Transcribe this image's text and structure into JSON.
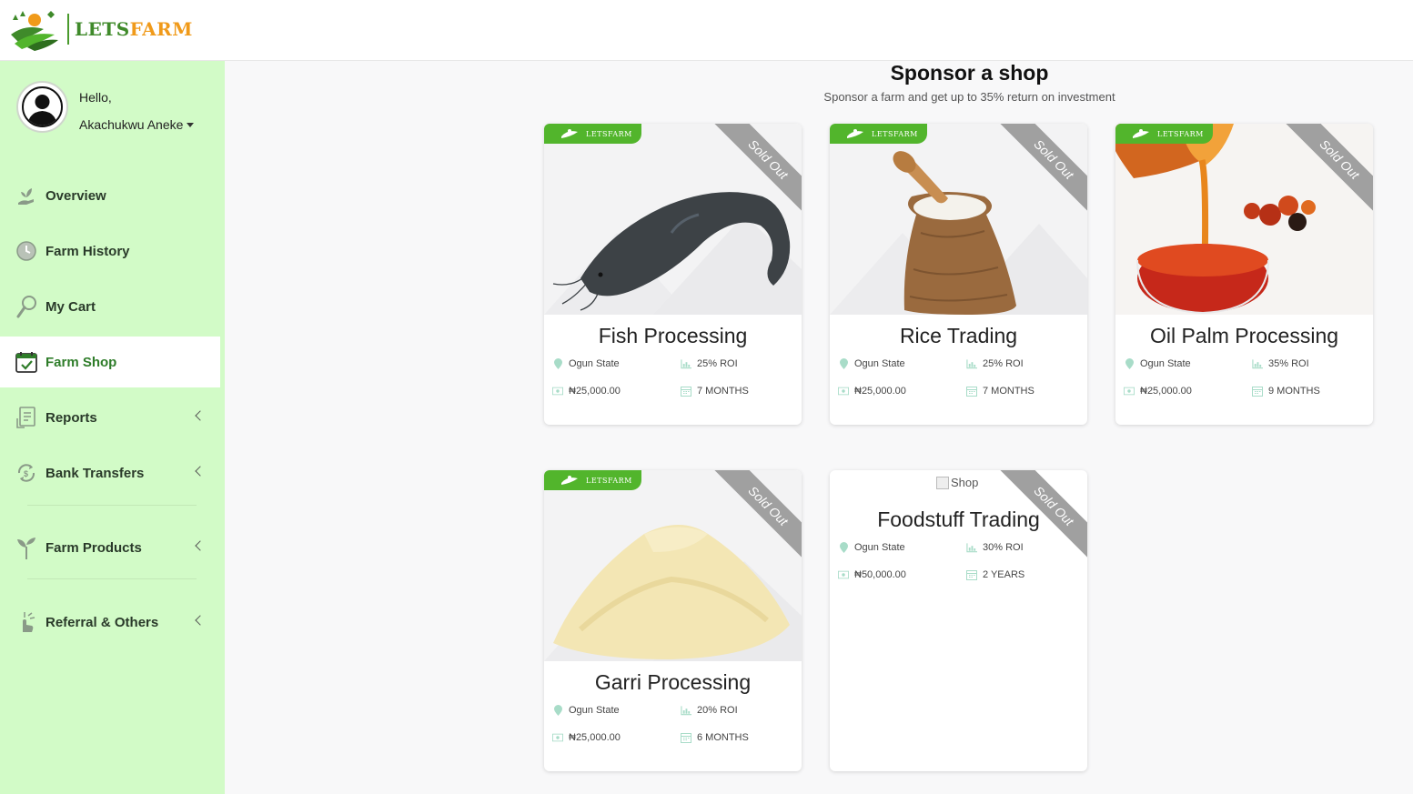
{
  "brand": {
    "lets": "LETS",
    "farm": "FARM",
    "tag_text": "LETSFARM"
  },
  "user": {
    "greeting": "Hello,",
    "name": "Akachukwu Aneke"
  },
  "nav": [
    {
      "label": "Overview",
      "icon": "hand-plant-icon",
      "active": false,
      "has_chevron": false
    },
    {
      "label": "Farm History",
      "icon": "clock-icon",
      "active": false,
      "has_chevron": false
    },
    {
      "label": "My Cart",
      "icon": "magnifier-icon",
      "active": false,
      "has_chevron": false
    },
    {
      "label": "Farm Shop",
      "icon": "calendar-check-icon",
      "active": true,
      "has_chevron": false
    },
    {
      "label": "Reports",
      "icon": "report-document-icon",
      "active": false,
      "has_chevron": true
    },
    {
      "label": "Bank Transfers",
      "icon": "money-transfer-icon",
      "active": false,
      "has_chevron": true
    },
    {
      "label": "Farm Products",
      "icon": "sprout-icon",
      "active": false,
      "has_chevron": true
    },
    {
      "label": "Referral & Others",
      "icon": "hand-pointer-icon",
      "active": false,
      "has_chevron": true
    }
  ],
  "page": {
    "title": "Sponsor a shop",
    "subtitle": "Sponsor a farm and get up to 35% return on investment"
  },
  "sold_out_label": "Sold Out",
  "cards": [
    {
      "name": "Fish Processing",
      "location": "Ogun State",
      "roi": "25% ROI",
      "price": "₦25,000.00",
      "duration": "7 MONTHS",
      "image": "catfish"
    },
    {
      "name": "Rice Trading",
      "location": "Ogun State",
      "roi": "25% ROI",
      "price": "₦25,000.00",
      "duration": "7 MONTHS",
      "image": "rice-sack"
    },
    {
      "name": "Oil Palm Processing",
      "location": "Ogun State",
      "roi": "35% ROI",
      "price": "₦25,000.00",
      "duration": "9 MONTHS",
      "image": "palm-oil"
    },
    {
      "name": "Garri Processing",
      "location": "Ogun State",
      "roi": "20% ROI",
      "price": "₦25,000.00",
      "duration": "6 MONTHS",
      "image": "garri"
    },
    {
      "name": "Foodstuff Trading",
      "location": "Ogun State",
      "roi": "30% ROI",
      "price": "₦50,000.00",
      "duration": "2 YEARS",
      "image": "broken",
      "alt_text": "Shop"
    }
  ],
  "colors": {
    "sidebar_bg": "#d2fbc7",
    "brand_green": "#52b52c",
    "brand_orange": "#f09a1a",
    "ribbon_grey": "#a0a0a0"
  }
}
